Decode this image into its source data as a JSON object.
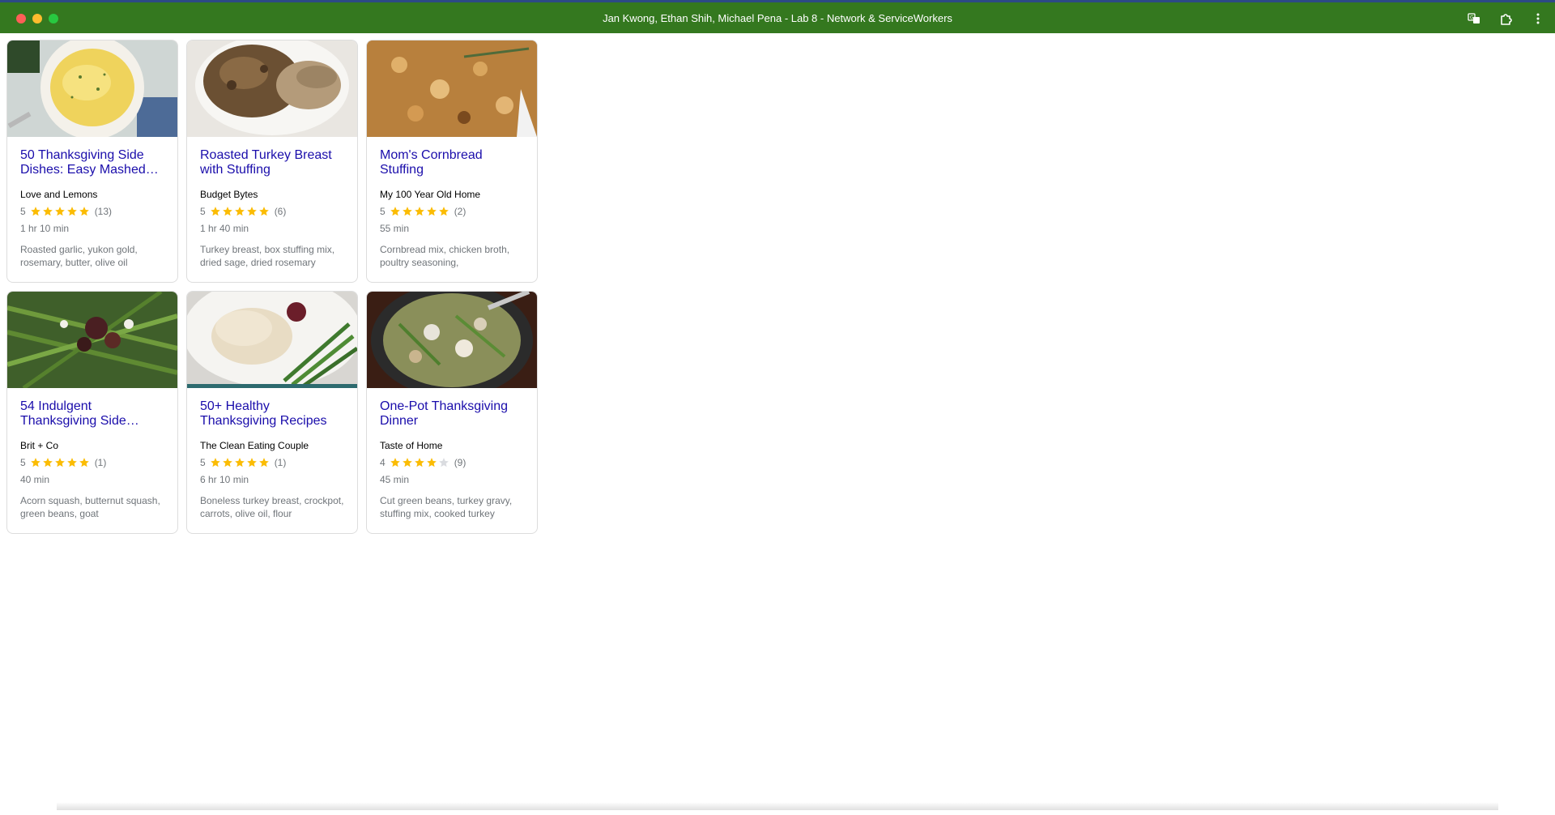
{
  "window": {
    "title": "Jan Kwong, Ethan Shih, Michael Pena - Lab 8 - Network & ServiceWorkers"
  },
  "icons": {
    "translate": "translate-icon",
    "extensions": "puzzle-piece-icon",
    "menu": "more-vert-icon"
  },
  "colors": {
    "titlebar": "#34781f",
    "link": "#1a0dab",
    "star_filled": "#fbbc04",
    "star_empty": "#dadce0",
    "muted_text": "#70757a"
  },
  "recipes": [
    {
      "title": "50 Thanksgiving Side Dishes: Easy Mashed…",
      "org": "Love and Lemons",
      "rating": "5",
      "stars": 5,
      "count": "(13)",
      "time": "1 hr 10 min",
      "ingredients": "Roasted garlic, yukon gold, rosemary, butter, olive oil"
    },
    {
      "title": "Roasted Turkey Breast with Stuffing",
      "org": "Budget Bytes",
      "rating": "5",
      "stars": 5,
      "count": "(6)",
      "time": "1 hr 40 min",
      "ingredients": "Turkey breast, box stuffing mix, dried sage, dried rosemary"
    },
    {
      "title": "Mom's Cornbread Stuffing",
      "org": "My 100 Year Old Home",
      "rating": "5",
      "stars": 5,
      "count": "(2)",
      "time": "55 min",
      "ingredients": "Cornbread mix, chicken broth, poultry seasoning,"
    },
    {
      "title": "54 Indulgent Thanksgiving Side…",
      "org": "Brit + Co",
      "rating": "5",
      "stars": 5,
      "count": "(1)",
      "time": "40 min",
      "ingredients": "Acorn squash, butternut squash, green beans, goat"
    },
    {
      "title": "50+ Healthy Thanksgiving Recipes",
      "org": "The Clean Eating Couple",
      "rating": "5",
      "stars": 5,
      "count": "(1)",
      "time": "6 hr 10 min",
      "ingredients": "Boneless turkey breast, crockpot, carrots, olive oil, flour"
    },
    {
      "title": "One-Pot Thanksgiving Dinner",
      "org": "Taste of Home",
      "rating": "4",
      "stars": 4,
      "count": "(9)",
      "time": "45 min",
      "ingredients": "Cut green beans, turkey gravy, stuffing mix, cooked turkey"
    }
  ]
}
